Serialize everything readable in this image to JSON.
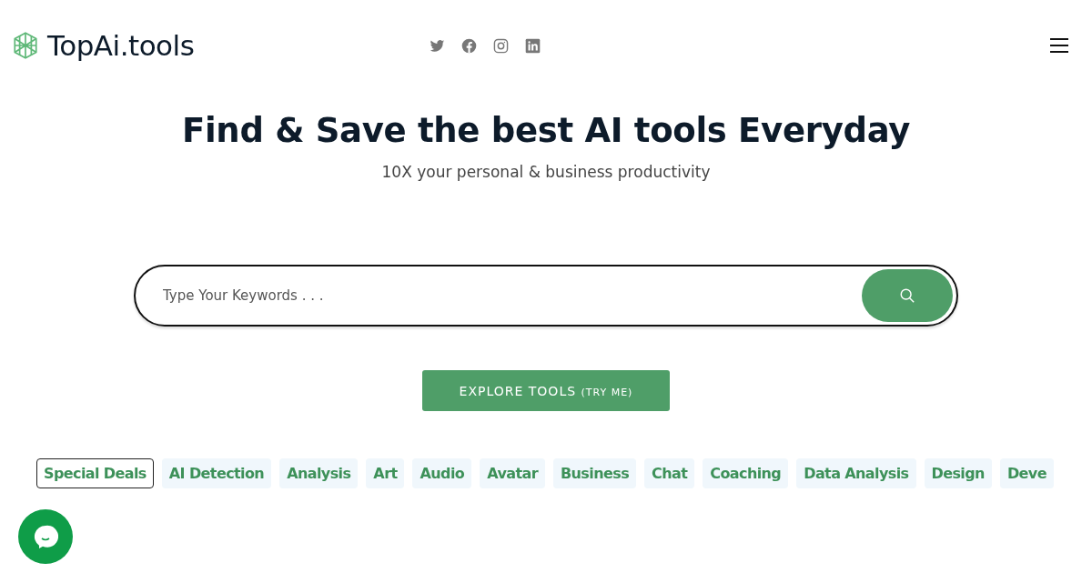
{
  "header": {
    "logo_text": "TopAi.tools",
    "social": [
      {
        "kind": "twitter"
      },
      {
        "kind": "facebook"
      },
      {
        "kind": "instagram"
      },
      {
        "kind": "linkedin"
      }
    ]
  },
  "hero": {
    "title": "Find & Save the best AI tools Everyday",
    "subtitle": "10X your personal & business productivity"
  },
  "search": {
    "placeholder": "Type Your Keywords . . ."
  },
  "explore_button": {
    "label": "EXPLORE TOOLS",
    "note": "(TRY ME)"
  },
  "categories": [
    {
      "label": "Special Deals",
      "selected": true
    },
    {
      "label": "AI Detection",
      "selected": false
    },
    {
      "label": "Analysis",
      "selected": false
    },
    {
      "label": "Art",
      "selected": false
    },
    {
      "label": "Audio",
      "selected": false
    },
    {
      "label": "Avatar",
      "selected": false
    },
    {
      "label": "Business",
      "selected": false
    },
    {
      "label": "Chat",
      "selected": false
    },
    {
      "label": "Coaching",
      "selected": false
    },
    {
      "label": "Data Analysis",
      "selected": false
    },
    {
      "label": "Design",
      "selected": false
    },
    {
      "label": "Deve",
      "selected": false
    }
  ]
}
